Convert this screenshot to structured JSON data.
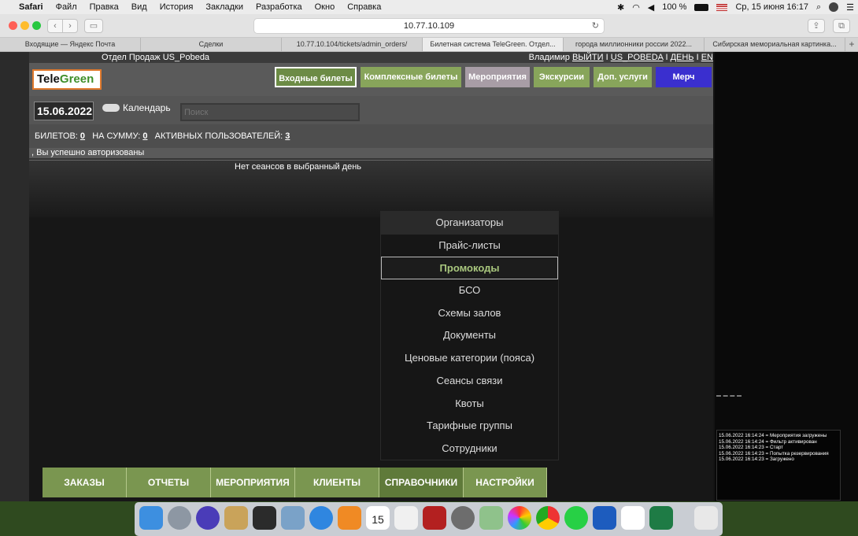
{
  "menubar": {
    "apple": "",
    "app": "Safari",
    "items": [
      "Файл",
      "Правка",
      "Вид",
      "История",
      "Закладки",
      "Разработка",
      "Окно",
      "Справка"
    ],
    "battery": "100 %",
    "datetime": "Ср, 15 июня  16:17"
  },
  "browser": {
    "url": "10.77.10.109",
    "tabs": [
      "Входящие — Яндекс Почта",
      "Сделки",
      "10.77.10.104/tickets/admin_orders/",
      "Билетная система TeleGreen. Отдел...",
      "города миллионники россии 2022...",
      "Сибирская мемориальная картинка..."
    ],
    "active_tab": 3
  },
  "app": {
    "department": "Отдел Продаж US_Pobeda",
    "user_name": "Владимир",
    "logout": "ВЫЙТИ",
    "sep": "I",
    "account": "US_POBEDA",
    "day": "ДЕНЬ",
    "lang": "EN",
    "logo": {
      "part1": "Tele",
      "part2": "Green"
    },
    "nav_buttons": [
      {
        "label": "Входные билеты",
        "color": "#6c8b45"
      },
      {
        "label": "Комплексные билеты",
        "color": "#88a55b"
      },
      {
        "label": "Мероприятия",
        "color": "#a89da6"
      },
      {
        "label": "Экскурсии",
        "color": "#88a55b"
      },
      {
        "label": "Доп. услуги",
        "color": "#88a55b"
      },
      {
        "label": "Мерч",
        "color": "#3a2fcf"
      }
    ],
    "date": "15.06.2022",
    "calendar_label": "Календарь",
    "search_placeholder": "Поиск",
    "stats": {
      "tickets_label": "БИЛЕТОВ:",
      "tickets": "0",
      "sum_label": "НА СУММУ:",
      "sum": "0",
      "users_label": "АКТИВНЫХ ПОЛЬЗОВАТЕЛЕЙ:",
      "users": "3"
    },
    "notice": ", Вы успешно авторизованы",
    "no_sessions": "Нет сеансов в выбранный день",
    "dropdown": [
      "Организаторы",
      "Прайс-листы",
      "Промокоды",
      "БСО",
      "Схемы залов",
      "Документы",
      "Ценовые категории (пояса)",
      "Сеансы связи",
      "Квоты",
      "Тарифные группы",
      "Сотрудники"
    ],
    "dropdown_selected": "Промокоды",
    "bottom_nav": [
      "ЗАКАЗЫ",
      "ОТЧЕТЫ",
      "МЕРОПРИЯТИЯ",
      "КЛИЕНТЫ",
      "СПРАВОЧНИКИ",
      "НАСТРОЙКИ"
    ],
    "bottom_active": "СПРАВОЧНИКИ"
  },
  "log": [
    "15.06.2022 16:14:24 = Мероприятия загружены",
    "15.06.2022 16:14:24 = Фильтр активирован",
    "15.06.2022 16:14:23 = Старт",
    "15.06.2022 16:14:23 = Попытка резервирования",
    "15.06.2022 16:14:23 = Загружено"
  ],
  "dock_apps": [
    "finder-icon",
    "launchpad-icon",
    "siri-icon",
    "notes-icon",
    "mission-control-icon",
    "preview-icon",
    "safari-icon",
    "books-icon",
    "calendar-icon",
    "music-icon",
    "photo-booth-icon",
    "system-preferences-icon",
    "maps-icon",
    "photos-icon",
    "chrome-icon",
    "whatsapp-icon",
    "word-icon",
    "slack-icon",
    "excel-icon",
    "trash-icon"
  ],
  "dock_calendar_day": "15"
}
